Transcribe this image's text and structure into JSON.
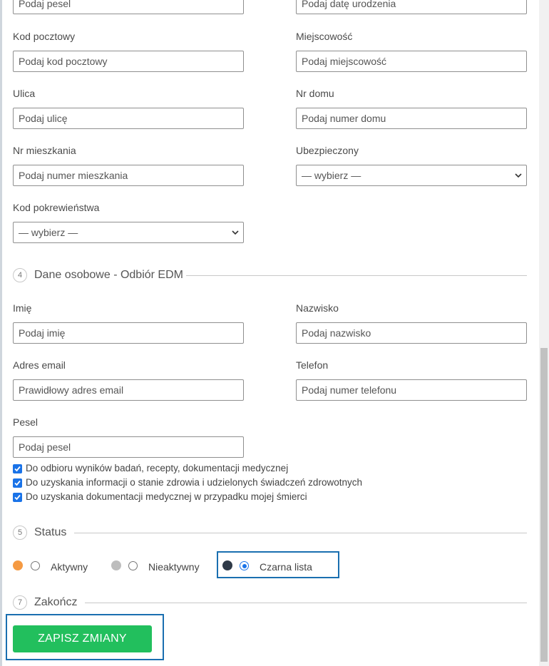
{
  "section3": {
    "pesel_placeholder": "Podaj pesel",
    "dob_placeholder": "Podaj datę urodzenia",
    "postal_label": "Kod pocztowy",
    "postal_placeholder": "Podaj kod pocztowy",
    "city_label": "Miejscowość",
    "city_placeholder": "Podaj miejscowość",
    "street_label": "Ulica",
    "street_placeholder": "Podaj ulicę",
    "house_label": "Nr domu",
    "house_placeholder": "Podaj numer domu",
    "apt_label": "Nr mieszkania",
    "apt_placeholder": "Podaj numer mieszkania",
    "insured_label": "Ubezpieczony",
    "insured_value": "— wybierz —",
    "kinship_label": "Kod pokrewieństwa",
    "kinship_value": "— wybierz —"
  },
  "section4": {
    "number": "4",
    "title": "Dane osobowe - Odbiór EDM",
    "firstname_label": "Imię",
    "firstname_placeholder": "Podaj imię",
    "lastname_label": "Nazwisko",
    "lastname_placeholder": "Podaj nazwisko",
    "email_label": "Adres email",
    "email_placeholder": "Prawidłowy adres email",
    "phone_label": "Telefon",
    "phone_placeholder": "Podaj numer telefonu",
    "pesel_label": "Pesel",
    "pesel_placeholder": "Podaj pesel",
    "consents": [
      {
        "label": "Do odbioru wyników badań, recepty, dokumentacji medycznej",
        "checked": true
      },
      {
        "label": "Do uzyskania informacji o stanie zdrowia i udzielonych świadczeń zdrowotnych",
        "checked": true
      },
      {
        "label": "Do uzyskania dokumentacji medycznej w przypadku mojej śmierci",
        "checked": true
      }
    ]
  },
  "section5": {
    "number": "5",
    "title": "Status",
    "options": [
      {
        "label": "Aktywny",
        "color": "#f59a42",
        "selected": false
      },
      {
        "label": "Nieaktywny",
        "color": "#bdbdbd",
        "selected": false
      },
      {
        "label": "Czarna lista",
        "color": "#2f3a48",
        "selected": true
      }
    ]
  },
  "section7": {
    "number": "7",
    "title": "Zakończ",
    "save_label": "ZAPISZ ZMIANY"
  },
  "colors": {
    "accent": "#1a73e8",
    "save_button": "#22bf5d",
    "highlight": "#1a6fb0"
  }
}
